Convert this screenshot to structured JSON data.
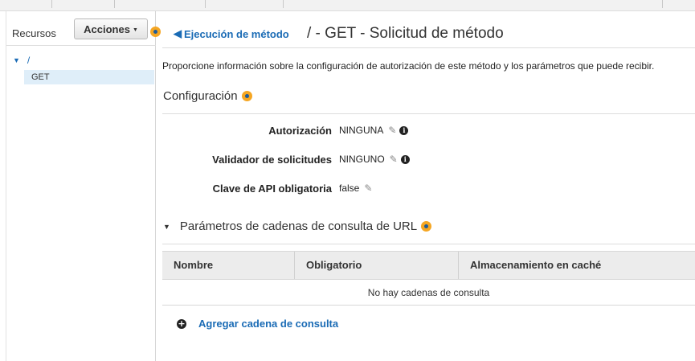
{
  "sidebar": {
    "resources_label": "Recursos",
    "actions_label": "Acciones",
    "tree": {
      "root": "/",
      "method": "GET"
    }
  },
  "header": {
    "back_link": "Ejecución de método",
    "title": "/ - GET - Solicitud de método"
  },
  "description": "Proporcione información sobre la configuración de autorización de este método y los parámetros que puede recibir.",
  "configuration": {
    "title": "Configuración",
    "rows": [
      {
        "label": "Autorización",
        "value": "NINGUNA"
      },
      {
        "label": "Validador de solicitudes",
        "value": "NINGUNO"
      },
      {
        "label": "Clave de API obligatoria",
        "value": "false"
      }
    ]
  },
  "query_params": {
    "title": "Parámetros de cadenas de consulta de URL",
    "columns": [
      "Nombre",
      "Obligatorio",
      "Almacenamiento en caché"
    ],
    "empty_text": "No hay cadenas de consulta",
    "add_label": "Agregar cadena de consulta"
  },
  "colors": {
    "link": "#1a6bb5",
    "help_dot": "#f5a623",
    "selected_row": "#dfeef9",
    "table_header": "#ececec"
  }
}
